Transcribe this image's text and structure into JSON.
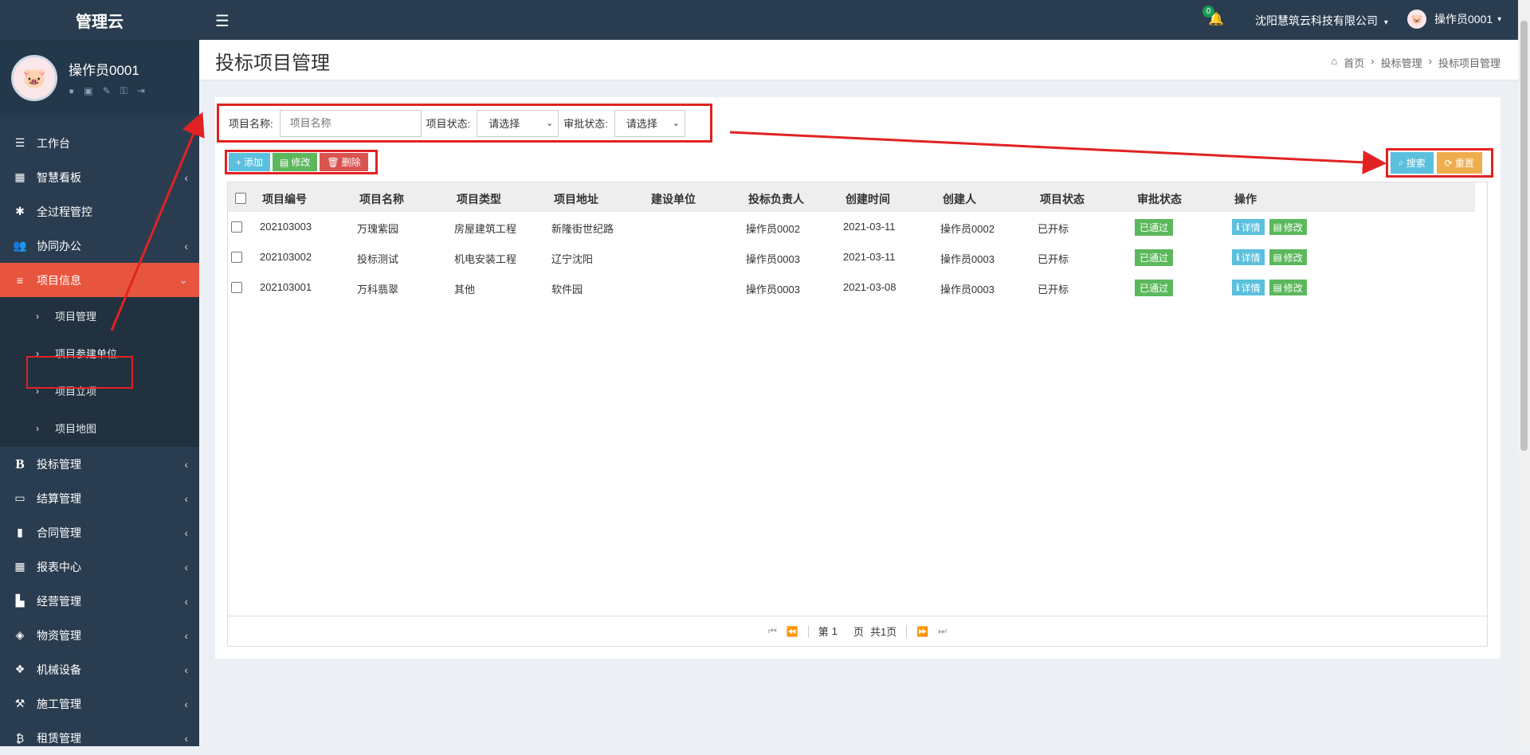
{
  "app": {
    "logo": "管理云"
  },
  "user_panel": {
    "name": "操作员0001",
    "icons": [
      "user-icon",
      "id-card-icon",
      "edit-icon",
      "key-icon",
      "logout-icon"
    ]
  },
  "sidebar": {
    "items": [
      {
        "label": "工作台",
        "icon": "list-icon",
        "chevron": ""
      },
      {
        "label": "智慧看板",
        "icon": "dashboard-icon",
        "chevron": "‹"
      },
      {
        "label": "全过程管控",
        "icon": "asterisk-icon",
        "chevron": ""
      },
      {
        "label": "协同办公",
        "icon": "users-icon",
        "chevron": "‹"
      },
      {
        "label": "项目信息",
        "icon": "bars-icon",
        "chevron": "⌄"
      }
    ],
    "sub_items": [
      {
        "label": "项目管理"
      },
      {
        "label": "项目参建单位"
      },
      {
        "label": "项目立项"
      },
      {
        "label": "项目地图"
      }
    ],
    "items_after": [
      {
        "label": "投标管理",
        "icon": "bold-b-icon",
        "chevron": "‹"
      },
      {
        "label": "结算管理",
        "icon": "desktop-icon",
        "chevron": "‹"
      },
      {
        "label": "合同管理",
        "icon": "file-icon",
        "chevron": "‹"
      },
      {
        "label": "报表中心",
        "icon": "table-icon",
        "chevron": "‹"
      },
      {
        "label": "经营管理",
        "icon": "bar-chart-icon",
        "chevron": "‹"
      },
      {
        "label": "物资管理",
        "icon": "cube-icon",
        "chevron": "‹"
      },
      {
        "label": "机械设备",
        "icon": "cubes-icon",
        "chevron": "‹"
      },
      {
        "label": "施工管理",
        "icon": "gavel-icon",
        "chevron": "‹"
      },
      {
        "label": "租赁管理",
        "icon": "bitcoin-icon",
        "chevron": "‹"
      }
    ]
  },
  "topbar": {
    "notification_count": "0",
    "company": "沈阳慧筑云科技有限公司",
    "user": "操作员0001"
  },
  "header": {
    "title": "投标项目管理",
    "breadcrumb": [
      "首页",
      "投标管理",
      "投标项目管理"
    ]
  },
  "search": {
    "name_label": "项目名称:",
    "name_placeholder": "项目名称",
    "status_label": "项目状态:",
    "status_value": "请选择",
    "audit_label": "审批状态:",
    "audit_value": "请选择",
    "search_btn": "搜索",
    "reset_btn": "重置"
  },
  "toolbar": {
    "add": "添加",
    "edit": "修改",
    "delete": "删除"
  },
  "table": {
    "columns": [
      "项目编号",
      "项目名称",
      "项目类型",
      "项目地址",
      "建设单位",
      "投标负责人",
      "创建时间",
      "创建人",
      "项目状态",
      "审批状态",
      "操作"
    ],
    "rows": [
      [
        "202103003",
        "万瑰紫园",
        "房屋建筑工程",
        "新隆街世纪路",
        "",
        "操作员0002",
        "2021-03-11",
        "操作员0002",
        "已开标",
        "已通过"
      ],
      [
        "202103002",
        "投标测试",
        "机电安装工程",
        "辽宁沈阳",
        "",
        "操作员0003",
        "2021-03-11",
        "操作员0003",
        "已开标",
        "已通过"
      ],
      [
        "202103001",
        "万科翡翠",
        "其他",
        "软件园",
        "",
        "操作员0003",
        "2021-03-08",
        "操作员0003",
        "已开标",
        "已通过"
      ]
    ],
    "op_detail": "详情",
    "op_edit": "修改"
  },
  "pager": {
    "page_prefix": "第",
    "page_num": "1",
    "page_suffix": "页",
    "total": "共1页"
  },
  "colors": {
    "sidebar": "#2a3d50",
    "active": "#e8553f",
    "annotation": "#e22222"
  }
}
